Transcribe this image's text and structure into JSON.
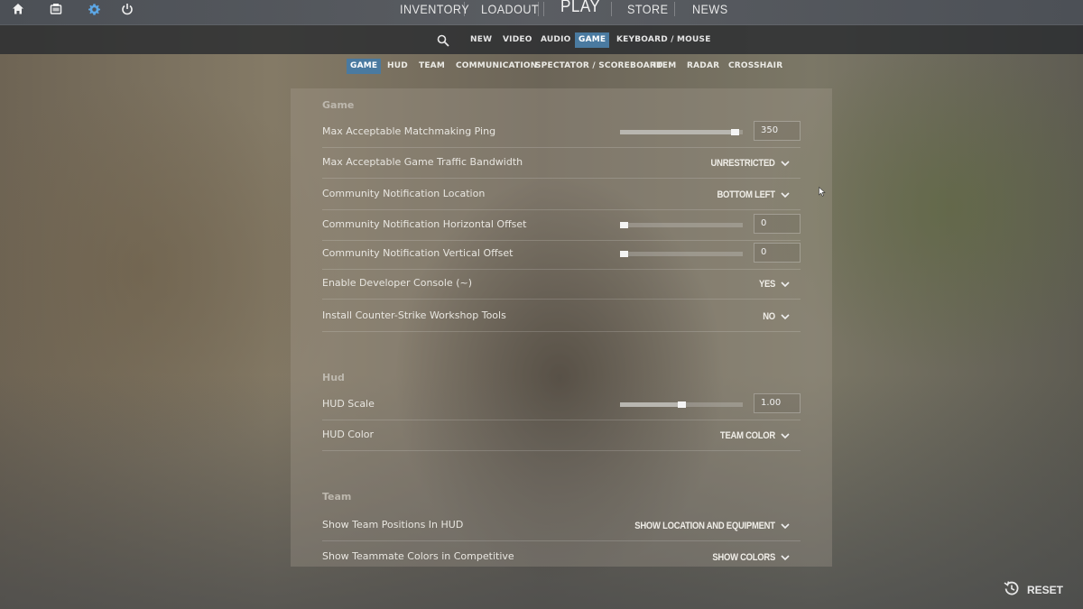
{
  "top_icons": [
    "home-icon",
    "inventory-box-icon",
    "settings-gear-icon",
    "power-icon"
  ],
  "nav": {
    "inventory": "INVENTORY",
    "loadout": "LOADOUT",
    "play": "PLAY",
    "store": "STORE",
    "news": "NEWS"
  },
  "tabs": {
    "search_icon": "search-icon",
    "items": [
      "NEW",
      "VIDEO",
      "AUDIO",
      "GAME",
      "KEYBOARD / MOUSE"
    ],
    "active": "GAME"
  },
  "subtabs": {
    "items": [
      "GAME",
      "HUD",
      "TEAM",
      "COMMUNICATION",
      "SPECTATOR / SCOREBOARD",
      "ITEM",
      "RADAR",
      "CROSSHAIR"
    ],
    "active": "GAME"
  },
  "sections": {
    "game": {
      "title": "Game",
      "rows": [
        {
          "label": "Max Acceptable Matchmaking Ping",
          "type": "slider",
          "value": "350",
          "fraction": 0.97
        },
        {
          "label": "Max Acceptable Game Traffic Bandwidth",
          "type": "dropdown",
          "value": "UNRESTRICTED"
        },
        {
          "label": "Community Notification Location",
          "type": "dropdown",
          "value": "BOTTOM LEFT"
        },
        {
          "label": "Community Notification Horizontal Offset",
          "type": "slider",
          "value": "0",
          "fraction": 0.0
        },
        {
          "label": "Community Notification Vertical Offset",
          "type": "slider",
          "value": "0",
          "fraction": 0.0
        },
        {
          "label": "Enable Developer Console (~)",
          "type": "dropdown",
          "value": "YES"
        },
        {
          "label": "Install Counter-Strike Workshop Tools",
          "type": "dropdown",
          "value": "NO"
        }
      ]
    },
    "hud": {
      "title": "Hud",
      "rows": [
        {
          "label": "HUD Scale",
          "type": "slider",
          "value": "1.00",
          "fraction": 0.5
        },
        {
          "label": "HUD Color",
          "type": "dropdown",
          "value": "TEAM COLOR"
        }
      ]
    },
    "team": {
      "title": "Team",
      "rows": [
        {
          "label": "Show Team Positions In HUD",
          "type": "dropdown",
          "value": "SHOW LOCATION AND EQUIPMENT"
        },
        {
          "label": "Show Teammate Colors in Competitive",
          "type": "dropdown",
          "value": "SHOW COLORS"
        }
      ]
    }
  },
  "footer": {
    "reset_label": "RESET",
    "reset_icon": "history-reset-icon"
  },
  "colors": {
    "accent": "#4a7aa0",
    "settings_icon": "#5ca7e6"
  }
}
